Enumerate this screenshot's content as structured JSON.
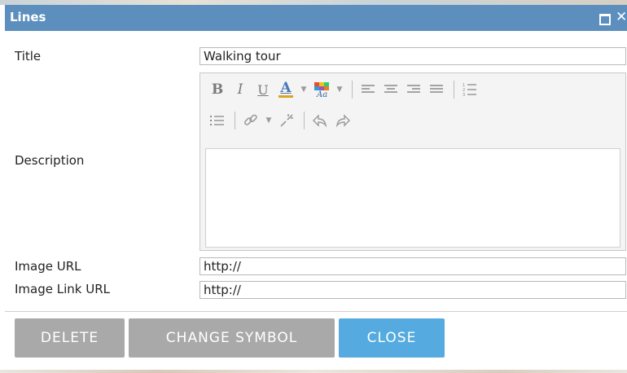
{
  "dialog": {
    "title": "Lines"
  },
  "form": {
    "title_label": "Title",
    "title_value": "Walking tour",
    "description_label": "Description",
    "image_url_label": "Image URL",
    "image_url_value": "http://",
    "image_link_label": "Image Link URL",
    "image_link_value": "http://"
  },
  "editor_toolbar": {
    "bold": "B",
    "italic": "I",
    "underline": "U",
    "font_color": "A"
  },
  "icons": [
    "maximize-icon",
    "close-icon",
    "font-color-icon",
    "highlight-color-icon",
    "align-left-icon",
    "align-center-icon",
    "align-right-icon",
    "align-justify-icon",
    "ordered-list-icon",
    "unordered-list-icon",
    "link-icon",
    "unlink-icon",
    "undo-icon",
    "redo-icon"
  ],
  "buttons": {
    "delete": "DELETE",
    "change_symbol": "CHANGE SYMBOL",
    "close": "CLOSE"
  },
  "colors": {
    "titlebar": "#5c8fbd",
    "button_gray": "#a9a9a9",
    "button_blue": "#55abdf"
  }
}
